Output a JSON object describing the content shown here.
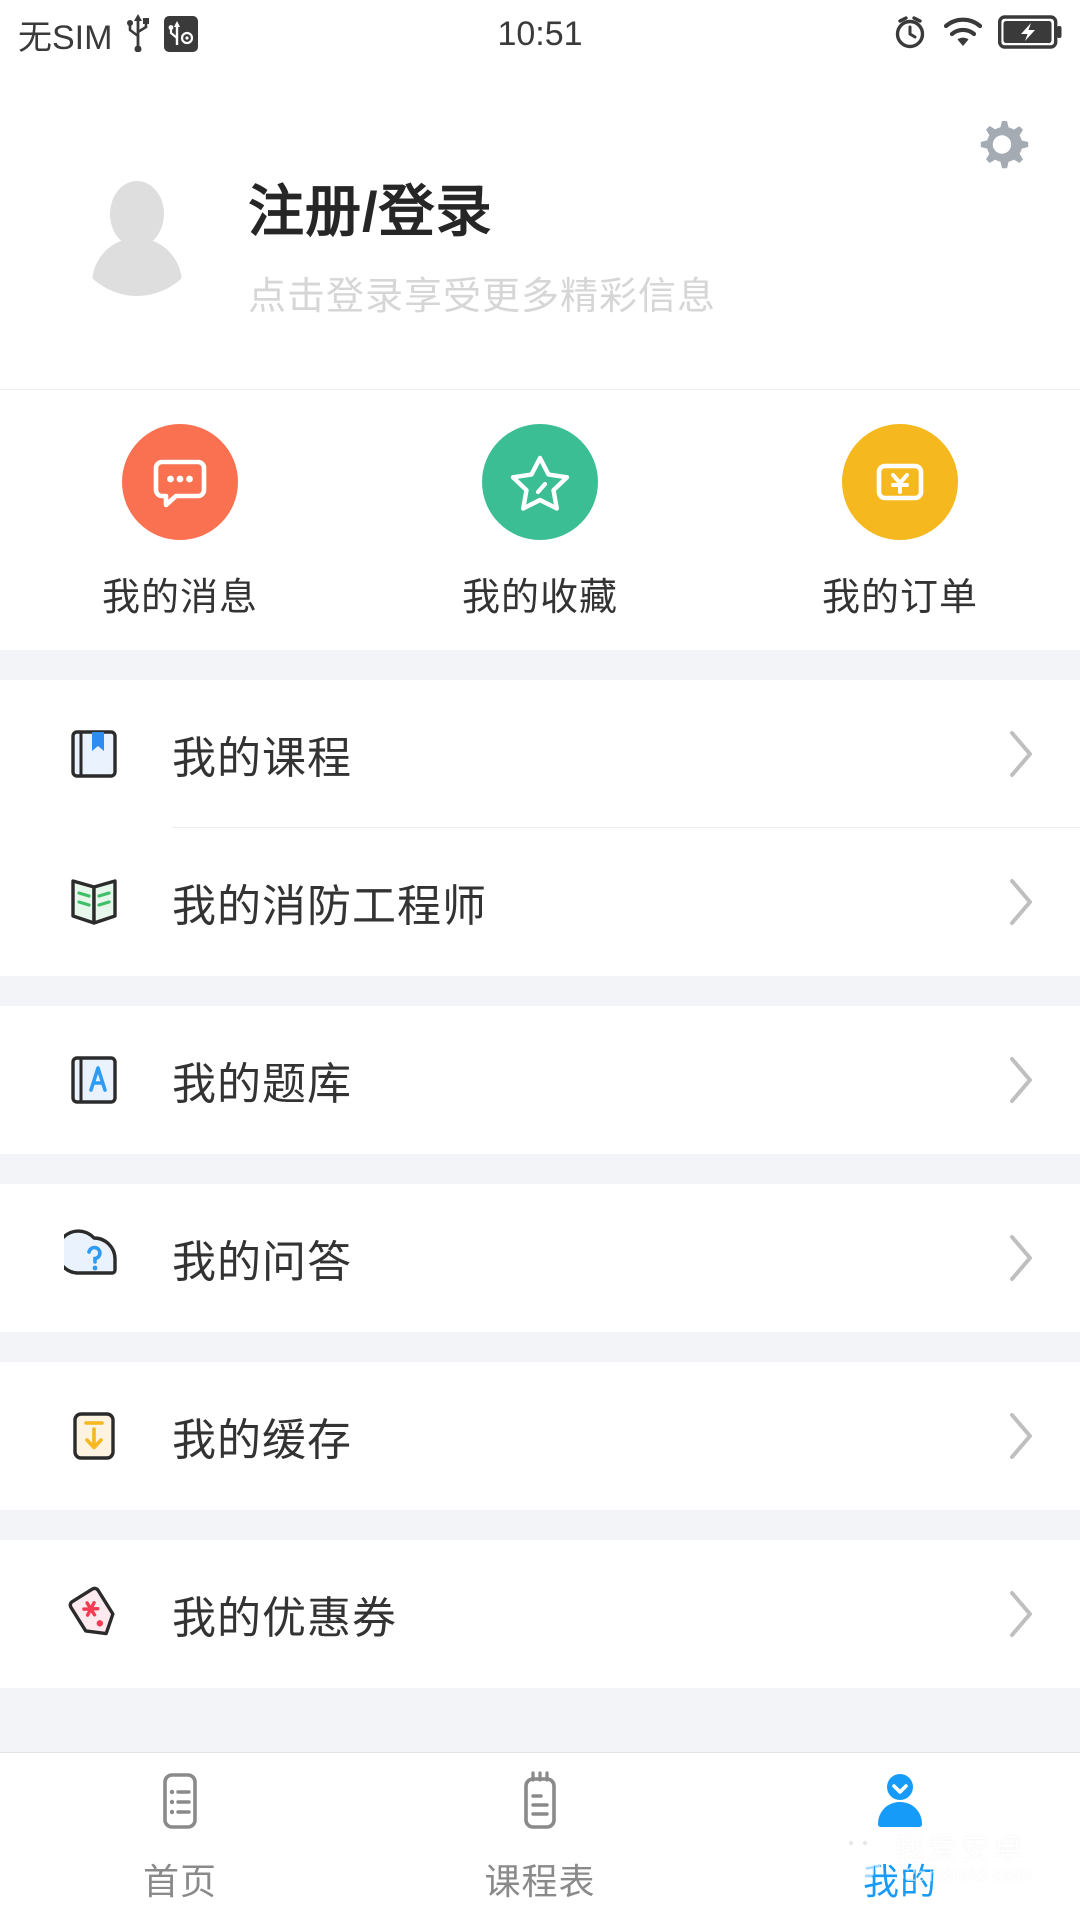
{
  "status_bar": {
    "carrier": "无SIM",
    "time": "10:51",
    "icons": [
      "usb-icon",
      "usb-debug-icon",
      "alarm-icon",
      "wifi-icon",
      "battery-charging-icon"
    ]
  },
  "header": {
    "title": "注册/登录",
    "subtitle": "点击登录享受更多精彩信息",
    "settings_icon": "gear-icon",
    "avatar_icon": "avatar-placeholder-icon"
  },
  "quick_actions": [
    {
      "label": "我的消息",
      "icon": "message-bubble-icon",
      "color": "#F97150"
    },
    {
      "label": "我的收藏",
      "icon": "star-icon",
      "color": "#3CBE94"
    },
    {
      "label": "我的订单",
      "icon": "yen-card-icon",
      "color": "#F5B81E"
    }
  ],
  "menu_sections": [
    {
      "rows": [
        {
          "label": "我的课程",
          "icon": "book-bookmark-icon",
          "accent": "#2E8BF0"
        },
        {
          "label": "我的消防工程师",
          "icon": "open-book-icon",
          "accent": "#3FBF6A"
        }
      ]
    },
    {
      "rows": [
        {
          "label": "我的题库",
          "icon": "book-letter-a-icon",
          "accent": "#2E9BF5"
        }
      ]
    },
    {
      "rows": [
        {
          "label": "我的问答",
          "icon": "question-bubble-icon",
          "accent": "#2E9BF5"
        }
      ]
    },
    {
      "rows": [
        {
          "label": "我的缓存",
          "icon": "download-box-icon",
          "accent": "#F5B81E"
        }
      ]
    },
    {
      "rows": [
        {
          "label": "我的优惠券",
          "icon": "coupon-tag-icon",
          "accent": "#F53B52"
        }
      ]
    }
  ],
  "chevron_icon": "chevron-right-icon",
  "tabbar": {
    "active_color": "#169BF9",
    "inactive_color": "#8A8A8A",
    "tabs": [
      {
        "label": "首页",
        "icon": "list-document-icon",
        "active": false
      },
      {
        "label": "课程表",
        "icon": "schedule-note-icon",
        "active": false
      },
      {
        "label": "我的",
        "icon": "person-icon",
        "active": true
      }
    ]
  },
  "watermark": {
    "line1": "我爱安卓",
    "line2": "52android.com",
    "icon": "android-robot-icon"
  }
}
